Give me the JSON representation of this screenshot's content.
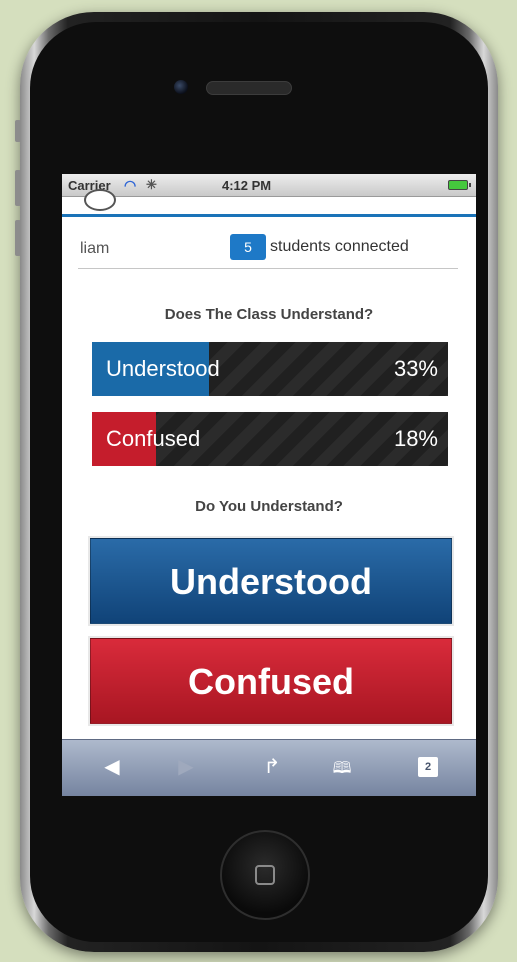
{
  "status_bar": {
    "carrier": "Carrier",
    "wifi_icon": "wifi-icon",
    "activity_icon": "activity-spinner-icon",
    "time": "4:12 PM",
    "battery_icon": "battery-icon"
  },
  "header": {
    "username": "liam",
    "connected_count": "5",
    "connected_label": "students connected"
  },
  "class_poll": {
    "title": "Does The Class Understand?",
    "results": [
      {
        "label": "Understood",
        "percent_text": "33%",
        "fraction": 0.33,
        "color": "#1a6aa8"
      },
      {
        "label": "Confused",
        "percent_text": "18%",
        "fraction": 0.18,
        "color": "#c51d2c"
      }
    ]
  },
  "your_vote": {
    "title": "Do You Understand?",
    "understood_label": "Understood",
    "confused_label": "Confused"
  },
  "browser_toolbar": {
    "back_icon": "back-arrow-icon",
    "forward_icon": "forward-arrow-icon",
    "share_icon": "share-icon",
    "bookmarks_icon": "bookmarks-icon",
    "tabs_count": "2"
  },
  "colors": {
    "accent_blue": "#1e79c7",
    "understood_blue": "#1a6aa8",
    "confused_red": "#c51d2c"
  }
}
